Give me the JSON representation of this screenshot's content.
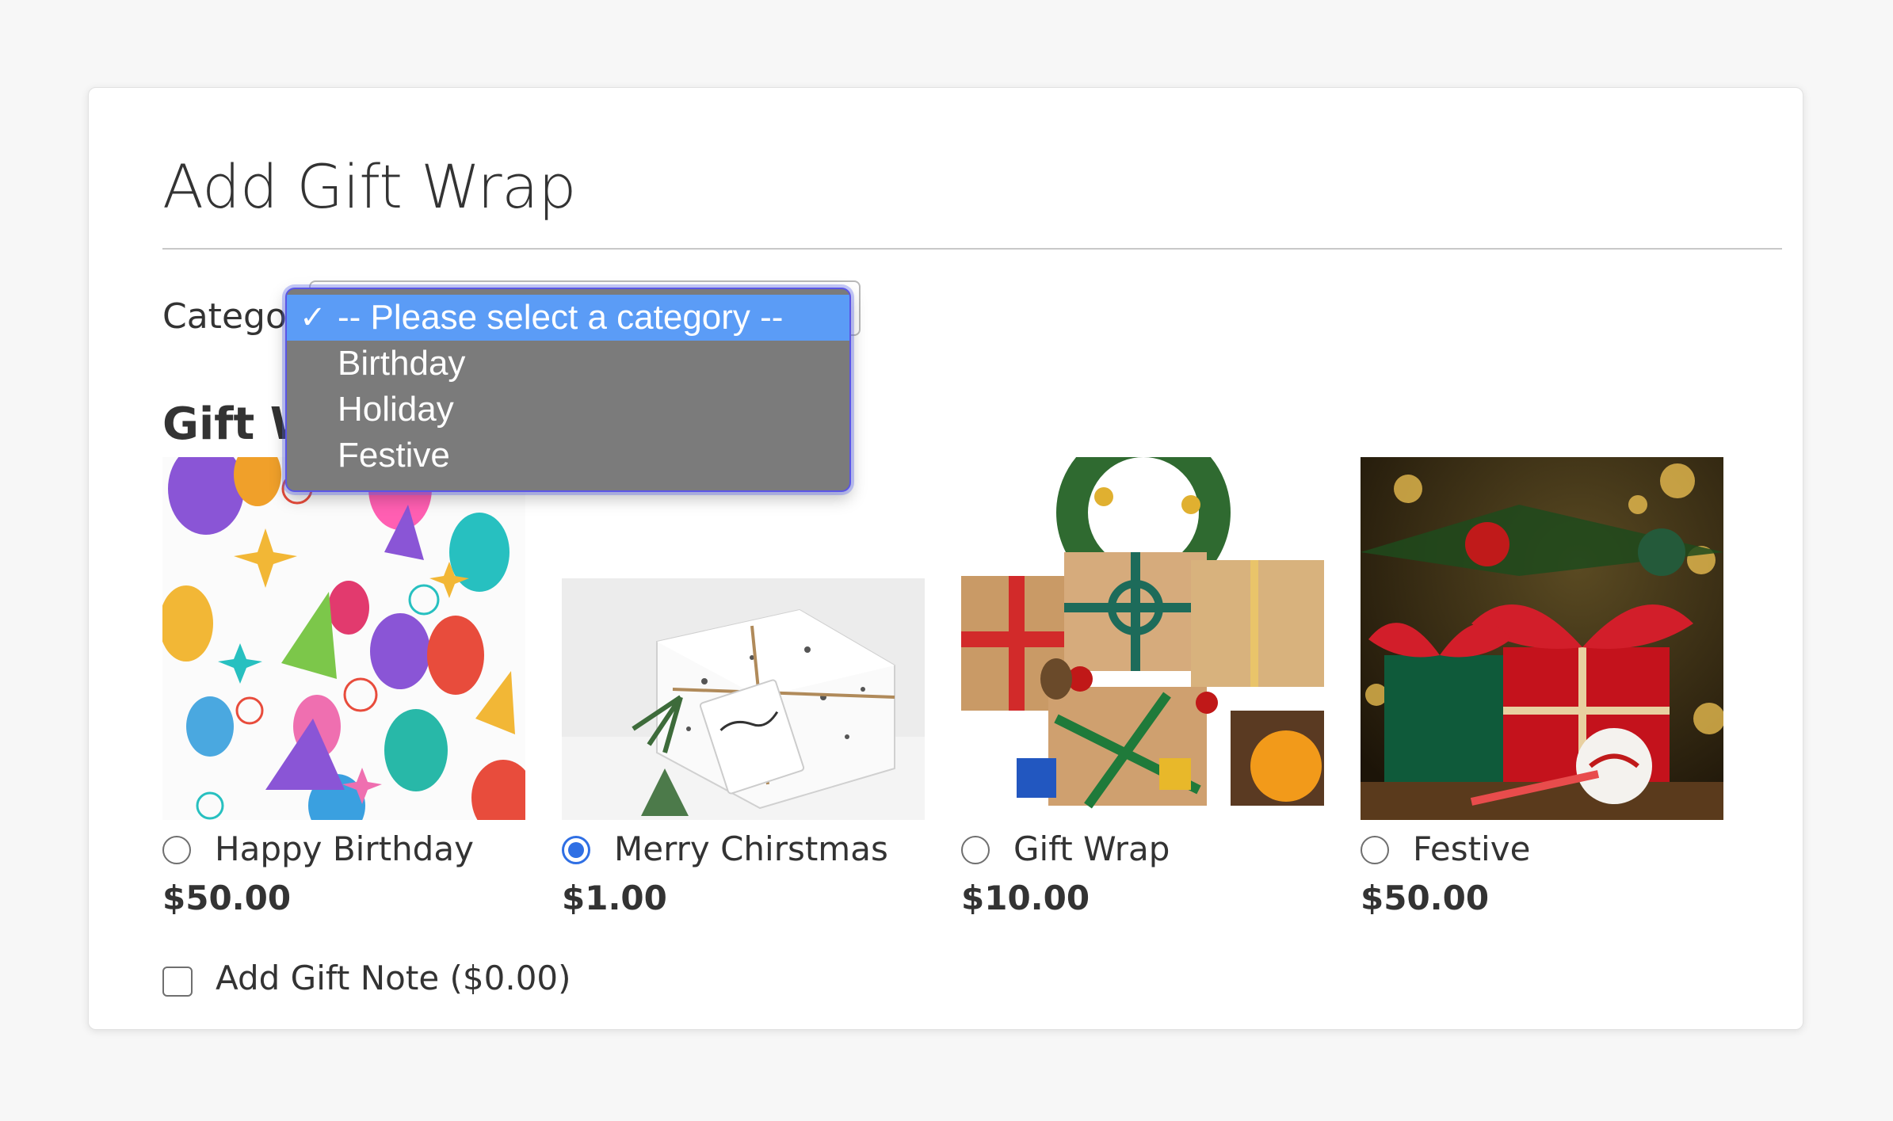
{
  "form": {
    "title": "Add Gift Wrap",
    "category_label": "Category",
    "section_heading": "Gift Wrap"
  },
  "category_select": {
    "open": true,
    "selected": "-- Please select a category --",
    "options": [
      {
        "label": "-- Please select a category --",
        "selected": true
      },
      {
        "label": "Birthday",
        "selected": false
      },
      {
        "label": "Holiday",
        "selected": false
      },
      {
        "label": "Festive",
        "selected": false
      }
    ],
    "check_glyph": "✓"
  },
  "products": [
    {
      "name": "Happy Birthday",
      "price": "$50.00",
      "checked": false,
      "image": "birthday-balloons-wrap"
    },
    {
      "name": "Merry Chirstmas",
      "price": "$1.00",
      "checked": true,
      "image": "white-christmas-gift-with-tag"
    },
    {
      "name": "Gift Wrap",
      "price": "$10.00",
      "checked": false,
      "image": "kraft-gift-boxes-with-wreath"
    },
    {
      "name": "Festive",
      "price": "$50.00",
      "checked": false,
      "image": "red-green-gift-boxes-bokeh"
    }
  ],
  "gift_note": {
    "label": "Add Gift Note ($0.00)",
    "checked": false
  },
  "colors": {
    "radio_checked": "#2f6fe4",
    "dropdown_highlight": "#5b9cf6",
    "dropdown_bg": "#7b7b7b"
  }
}
